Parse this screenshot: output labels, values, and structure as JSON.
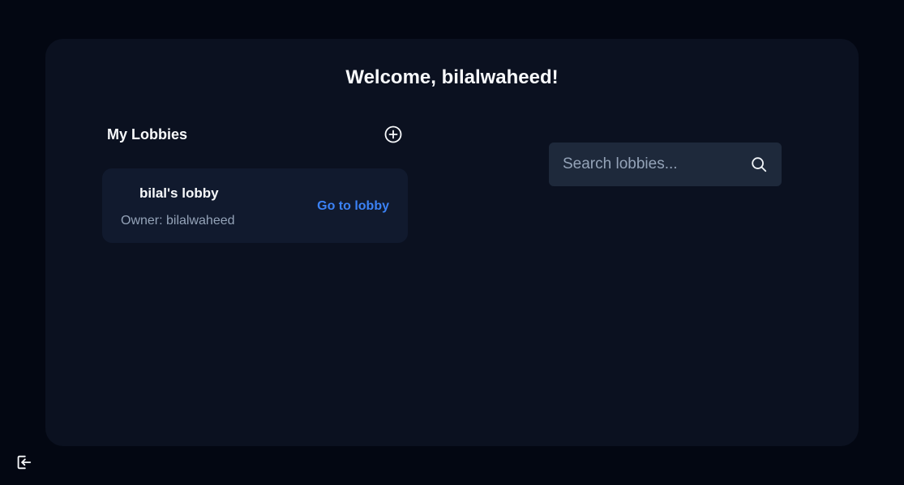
{
  "header": {
    "welcome": "Welcome, bilalwaheed!"
  },
  "my_lobbies": {
    "title": "My Lobbies",
    "add_icon": "plus-circle-icon",
    "items": [
      {
        "name": "bilal's lobby",
        "owner": "Owner: bilalwaheed",
        "action_label": "Go to lobby"
      }
    ]
  },
  "search": {
    "placeholder": "Search lobbies...",
    "value": "",
    "icon": "search-icon"
  },
  "footer": {
    "logout_icon": "logout-icon"
  },
  "colors": {
    "page_background": "#030712",
    "panel_background": "#0b1120",
    "card_background": "#111a2e",
    "search_background": "#1e293b",
    "accent_link": "#3b82f6",
    "primary_text": "#f8fafc",
    "muted_text": "#94a3b8"
  }
}
